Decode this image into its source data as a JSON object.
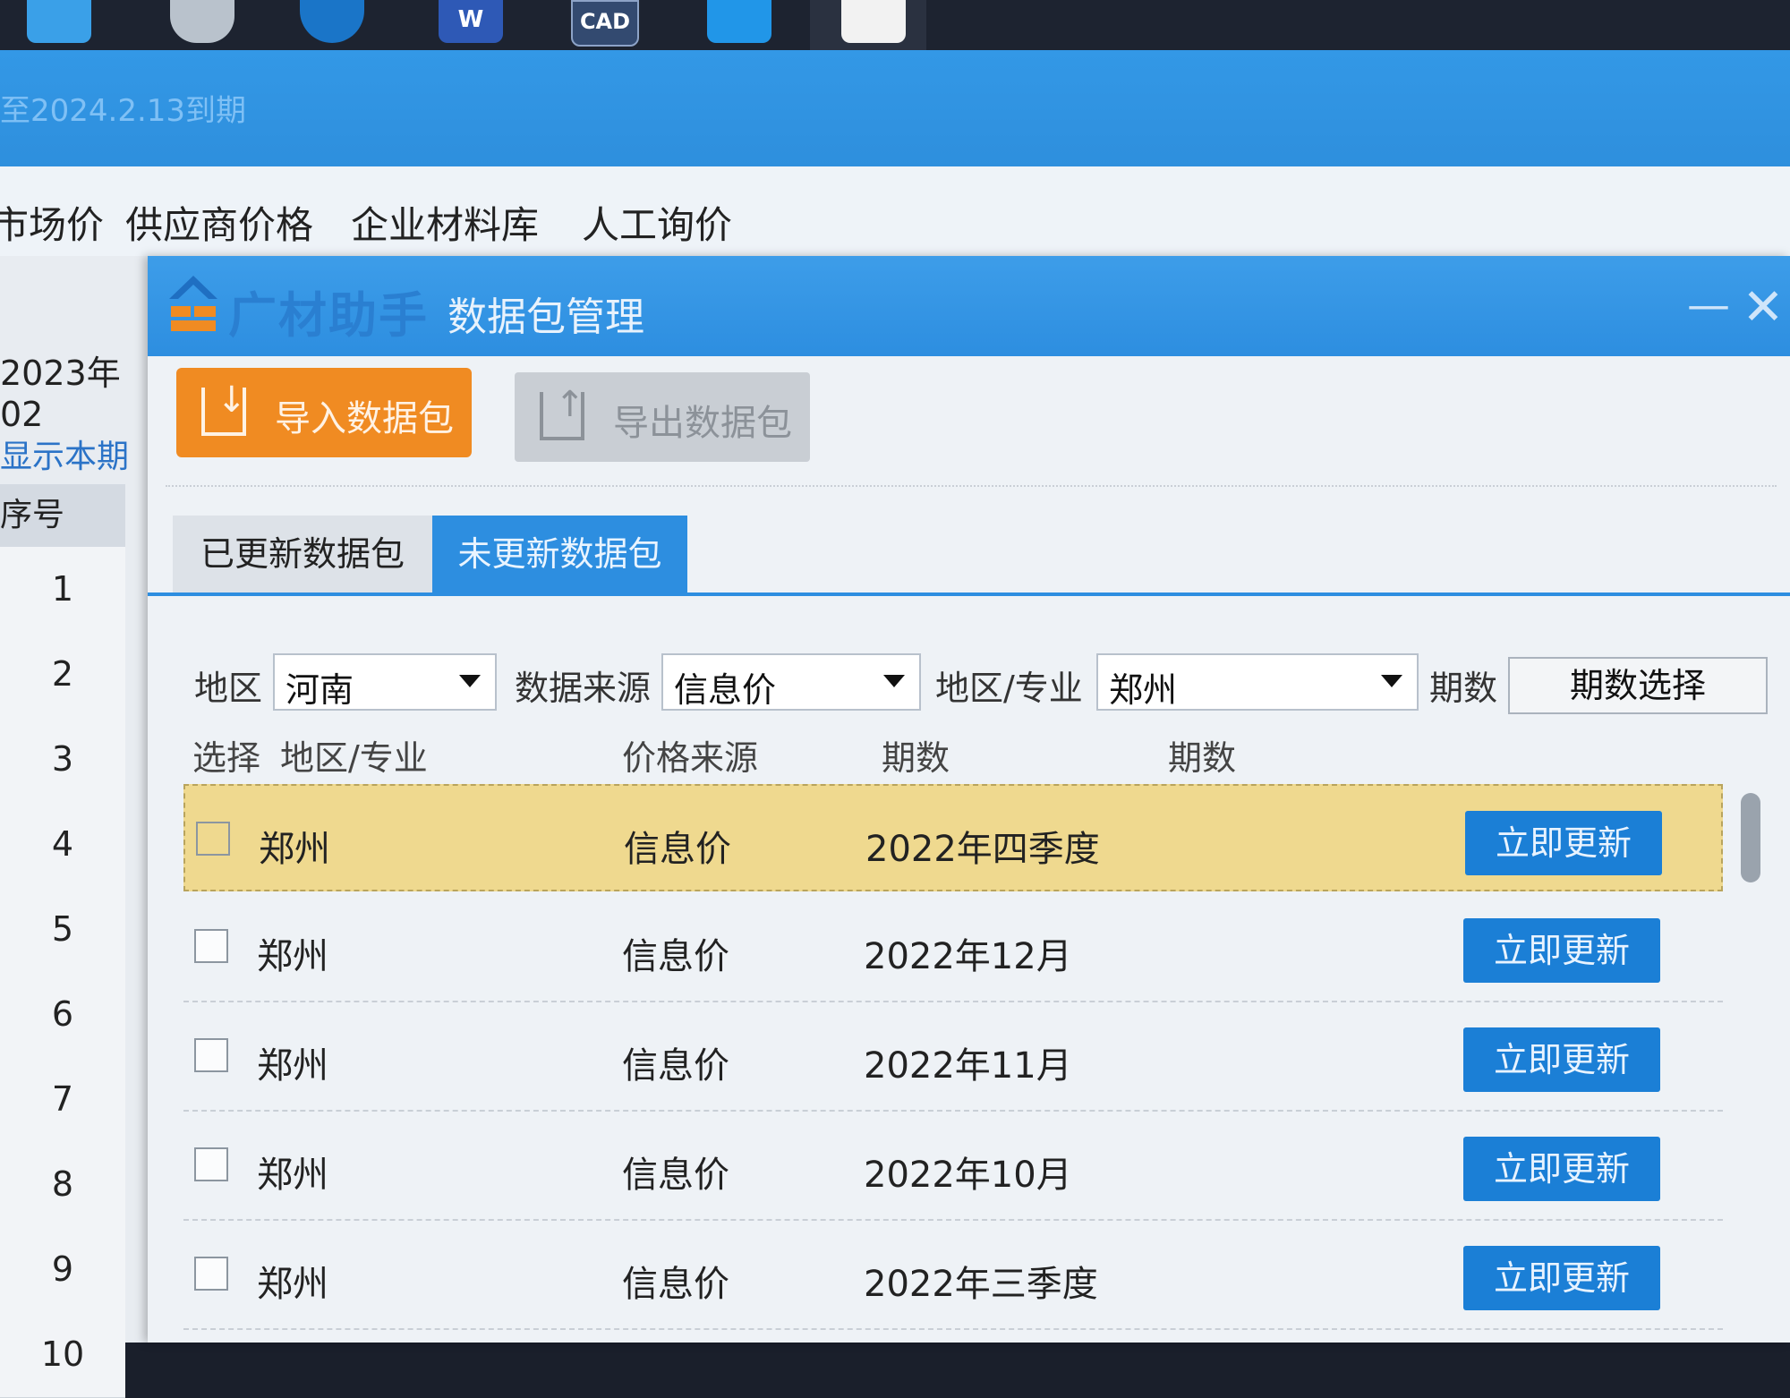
{
  "taskbar": {
    "icons": [
      {
        "name": "app1-icon",
        "label": ""
      },
      {
        "name": "chat-icon",
        "label": ""
      },
      {
        "name": "edge-icon",
        "label": ""
      },
      {
        "name": "word-icon",
        "label": "W"
      },
      {
        "name": "cad-icon",
        "label": "CAD"
      },
      {
        "name": "pin-icon",
        "label": ""
      },
      {
        "name": "guangcai-icon",
        "label": ""
      }
    ]
  },
  "bg_window": {
    "title": "至2024.2.13到期",
    "menu": [
      "市场价",
      "供应商价格",
      "企业材料库",
      "人工询价"
    ],
    "date": "2023年02",
    "link": "显示本期价",
    "col_index": "序号",
    "row_numbers": [
      "1",
      "2",
      "3",
      "4",
      "5",
      "6",
      "7",
      "8",
      "9",
      "10"
    ]
  },
  "dialog": {
    "brand": "广材助手",
    "title": "数据包管理",
    "import_label": "导入数据包",
    "export_label": "导出数据包",
    "tabs": [
      {
        "label": "已更新数据包",
        "active": false
      },
      {
        "label": "未更新数据包",
        "active": true
      }
    ],
    "filters": {
      "region_label": "地区",
      "region_value": "河南",
      "source_label": "数据来源",
      "source_value": "信息价",
      "area_label": "地区/专业",
      "area_value": "郑州",
      "period_label": "期数",
      "period_button": "期数选择"
    },
    "columns": [
      "选择",
      "地区/专业",
      "价格来源",
      "期数",
      "期数"
    ],
    "rows": [
      {
        "region": "郑州",
        "source": "信息价",
        "period": "2022年四季度",
        "action": "立即更新",
        "highlighted": true
      },
      {
        "region": "郑州",
        "source": "信息价",
        "period": "2022年12月",
        "action": "立即更新",
        "highlighted": false
      },
      {
        "region": "郑州",
        "source": "信息价",
        "period": "2022年11月",
        "action": "立即更新",
        "highlighted": false
      },
      {
        "region": "郑州",
        "source": "信息价",
        "period": "2022年10月",
        "action": "立即更新",
        "highlighted": false
      },
      {
        "region": "郑州",
        "source": "信息价",
        "period": "2022年三季度",
        "action": "立即更新",
        "highlighted": false
      }
    ]
  },
  "colors": {
    "accent_blue": "#2d8ee0",
    "import_orange": "#f08b22",
    "highlight_row": "#efd98f",
    "update_button": "#1b7fd6"
  }
}
